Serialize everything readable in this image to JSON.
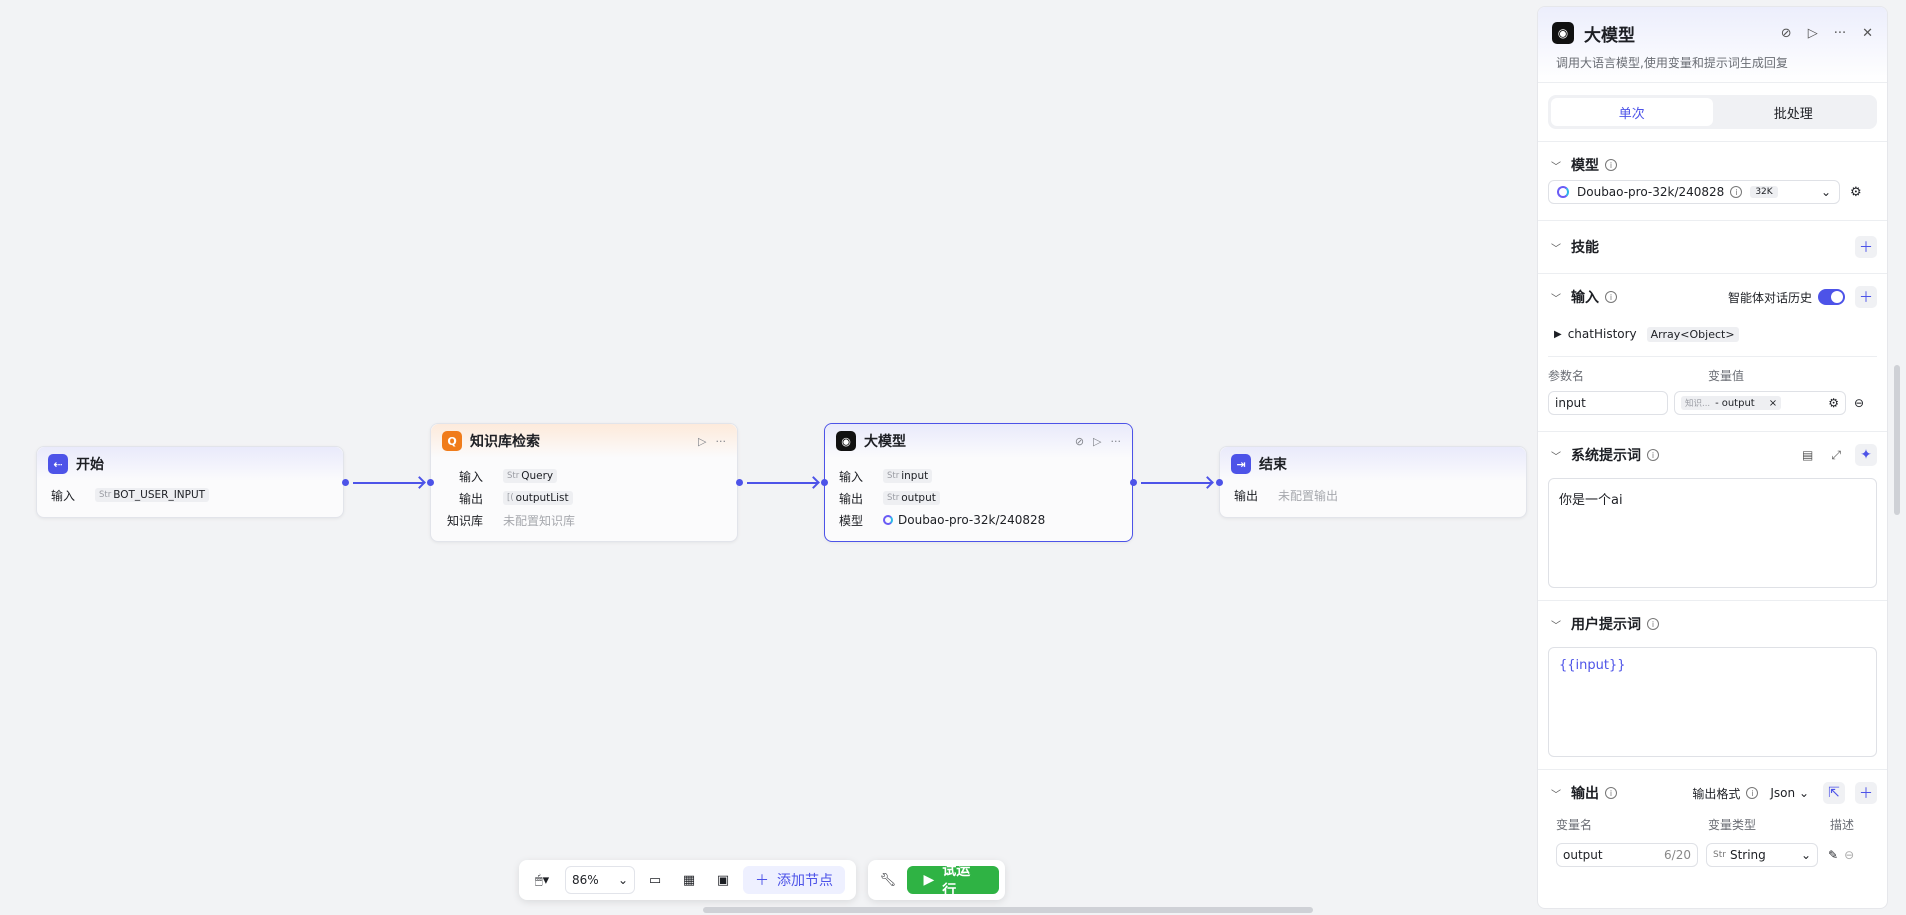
{
  "canvas": {
    "nodes": {
      "start": {
        "title": "开始",
        "icon": "start-icon",
        "rows": [
          {
            "label": "输入",
            "type": "Str",
            "value": "BOT_USER_INPUT"
          }
        ]
      },
      "kb": {
        "title": "知识库检索",
        "icon": "knowledge-icon",
        "rows": [
          {
            "label": "输入",
            "type": "Str",
            "value": "Query"
          },
          {
            "label": "输出",
            "type": "[(",
            "value": "outputList"
          },
          {
            "label": "知识库",
            "muted": "未配置知识库"
          }
        ]
      },
      "llm": {
        "title": "大模型",
        "icon": "llm-icon",
        "rows": [
          {
            "label": "输入",
            "type": "Str",
            "value": "input"
          },
          {
            "label": "输出",
            "type": "Str",
            "value": "output"
          },
          {
            "label": "模型",
            "value": "Doubao-pro-32k/240828"
          }
        ]
      },
      "end": {
        "title": "结束",
        "icon": "end-icon",
        "rows": [
          {
            "label": "输出",
            "muted": "未配置输出"
          }
        ]
      }
    }
  },
  "toolbar": {
    "zoom": "86%",
    "add_node": "添加节点",
    "run": "试运行"
  },
  "panel": {
    "title": "大模型",
    "desc": "调用大语言模型,使用变量和提示词生成回复",
    "tabs": [
      "单次",
      "批处理"
    ],
    "model": {
      "title": "模型",
      "value": "Doubao-pro-32k/240828",
      "badge": "32K"
    },
    "skills": {
      "title": "技能"
    },
    "input": {
      "title": "输入",
      "history_label": "智能体对话历史",
      "chat_history_name": "chatHistory",
      "chat_history_type": "Array<Object>",
      "param_name_label": "参数名",
      "param_value_label": "变量值",
      "param_name": "input",
      "param_ref_node": "知识...",
      "param_ref_var": "output"
    },
    "system_prompt": {
      "title": "系统提示词",
      "text": "你是一个ai"
    },
    "user_prompt": {
      "title": "用户提示词",
      "text": "{{input}}"
    },
    "output": {
      "title": "输出",
      "format_label": "输出格式",
      "format": "Json",
      "col_name": "变量名",
      "col_type": "变量类型",
      "col_desc": "描述",
      "var_name": "output",
      "var_count": "6/20",
      "var_type": "String"
    }
  },
  "colors": {
    "accent": "#4d53e8",
    "run": "#2fb344",
    "kb": "#f07c1b"
  }
}
